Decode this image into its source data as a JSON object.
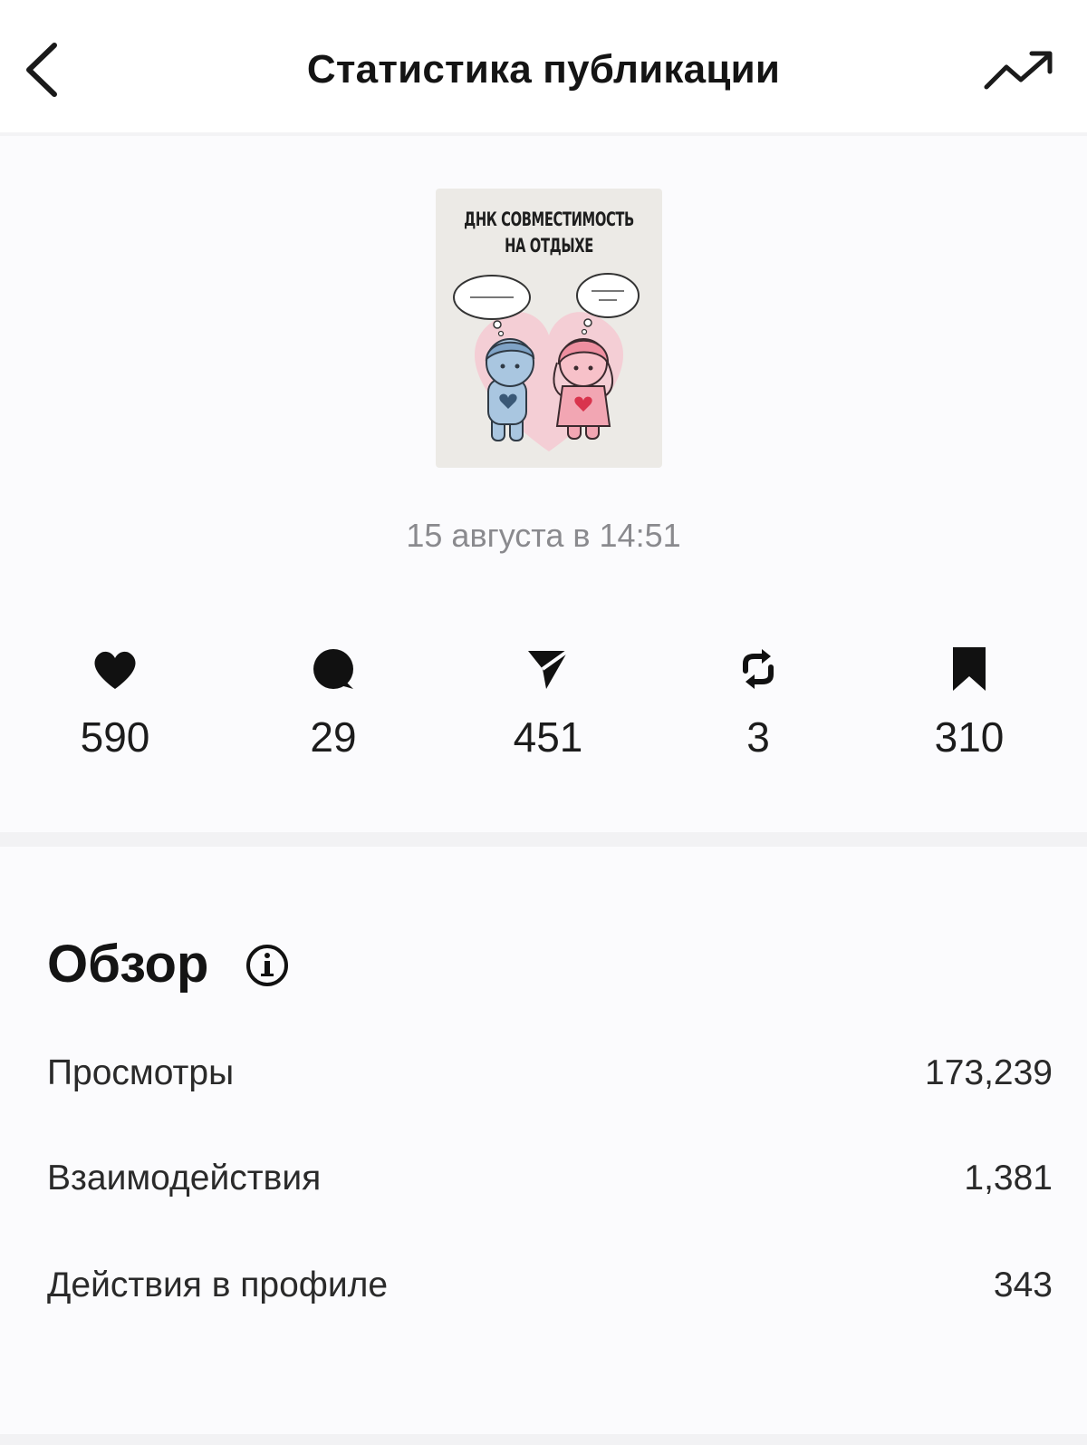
{
  "header": {
    "title": "Статистика публикации",
    "back_icon": "chevron-left-icon",
    "trend_icon": "trending-up-icon"
  },
  "post": {
    "thumbnail_title_line1": "ДНК СОВМЕСТИМОСТЬ",
    "thumbnail_title_line2": "НА ОТДЫХЕ",
    "date": "15 августа в 14:51"
  },
  "metrics": [
    {
      "icon": "heart-icon",
      "value": "590"
    },
    {
      "icon": "comment-icon",
      "value": "29"
    },
    {
      "icon": "share-icon",
      "value": "451"
    },
    {
      "icon": "repost-icon",
      "value": "3"
    },
    {
      "icon": "bookmark-icon",
      "value": "310"
    }
  ],
  "overview": {
    "title": "Обзор",
    "info_icon": "info-icon",
    "rows": [
      {
        "label": "Просмотры",
        "value": "173,239"
      },
      {
        "label": "Взаимодействия",
        "value": "1,381"
      },
      {
        "label": "Действия в профиле",
        "value": "343"
      }
    ]
  },
  "colors": {
    "background": "#fbfbfd",
    "text": "#111111",
    "muted": "#8a8a8e",
    "thumb_blue": "#a9c6e0",
    "thumb_pink": "#f2a6b3"
  }
}
